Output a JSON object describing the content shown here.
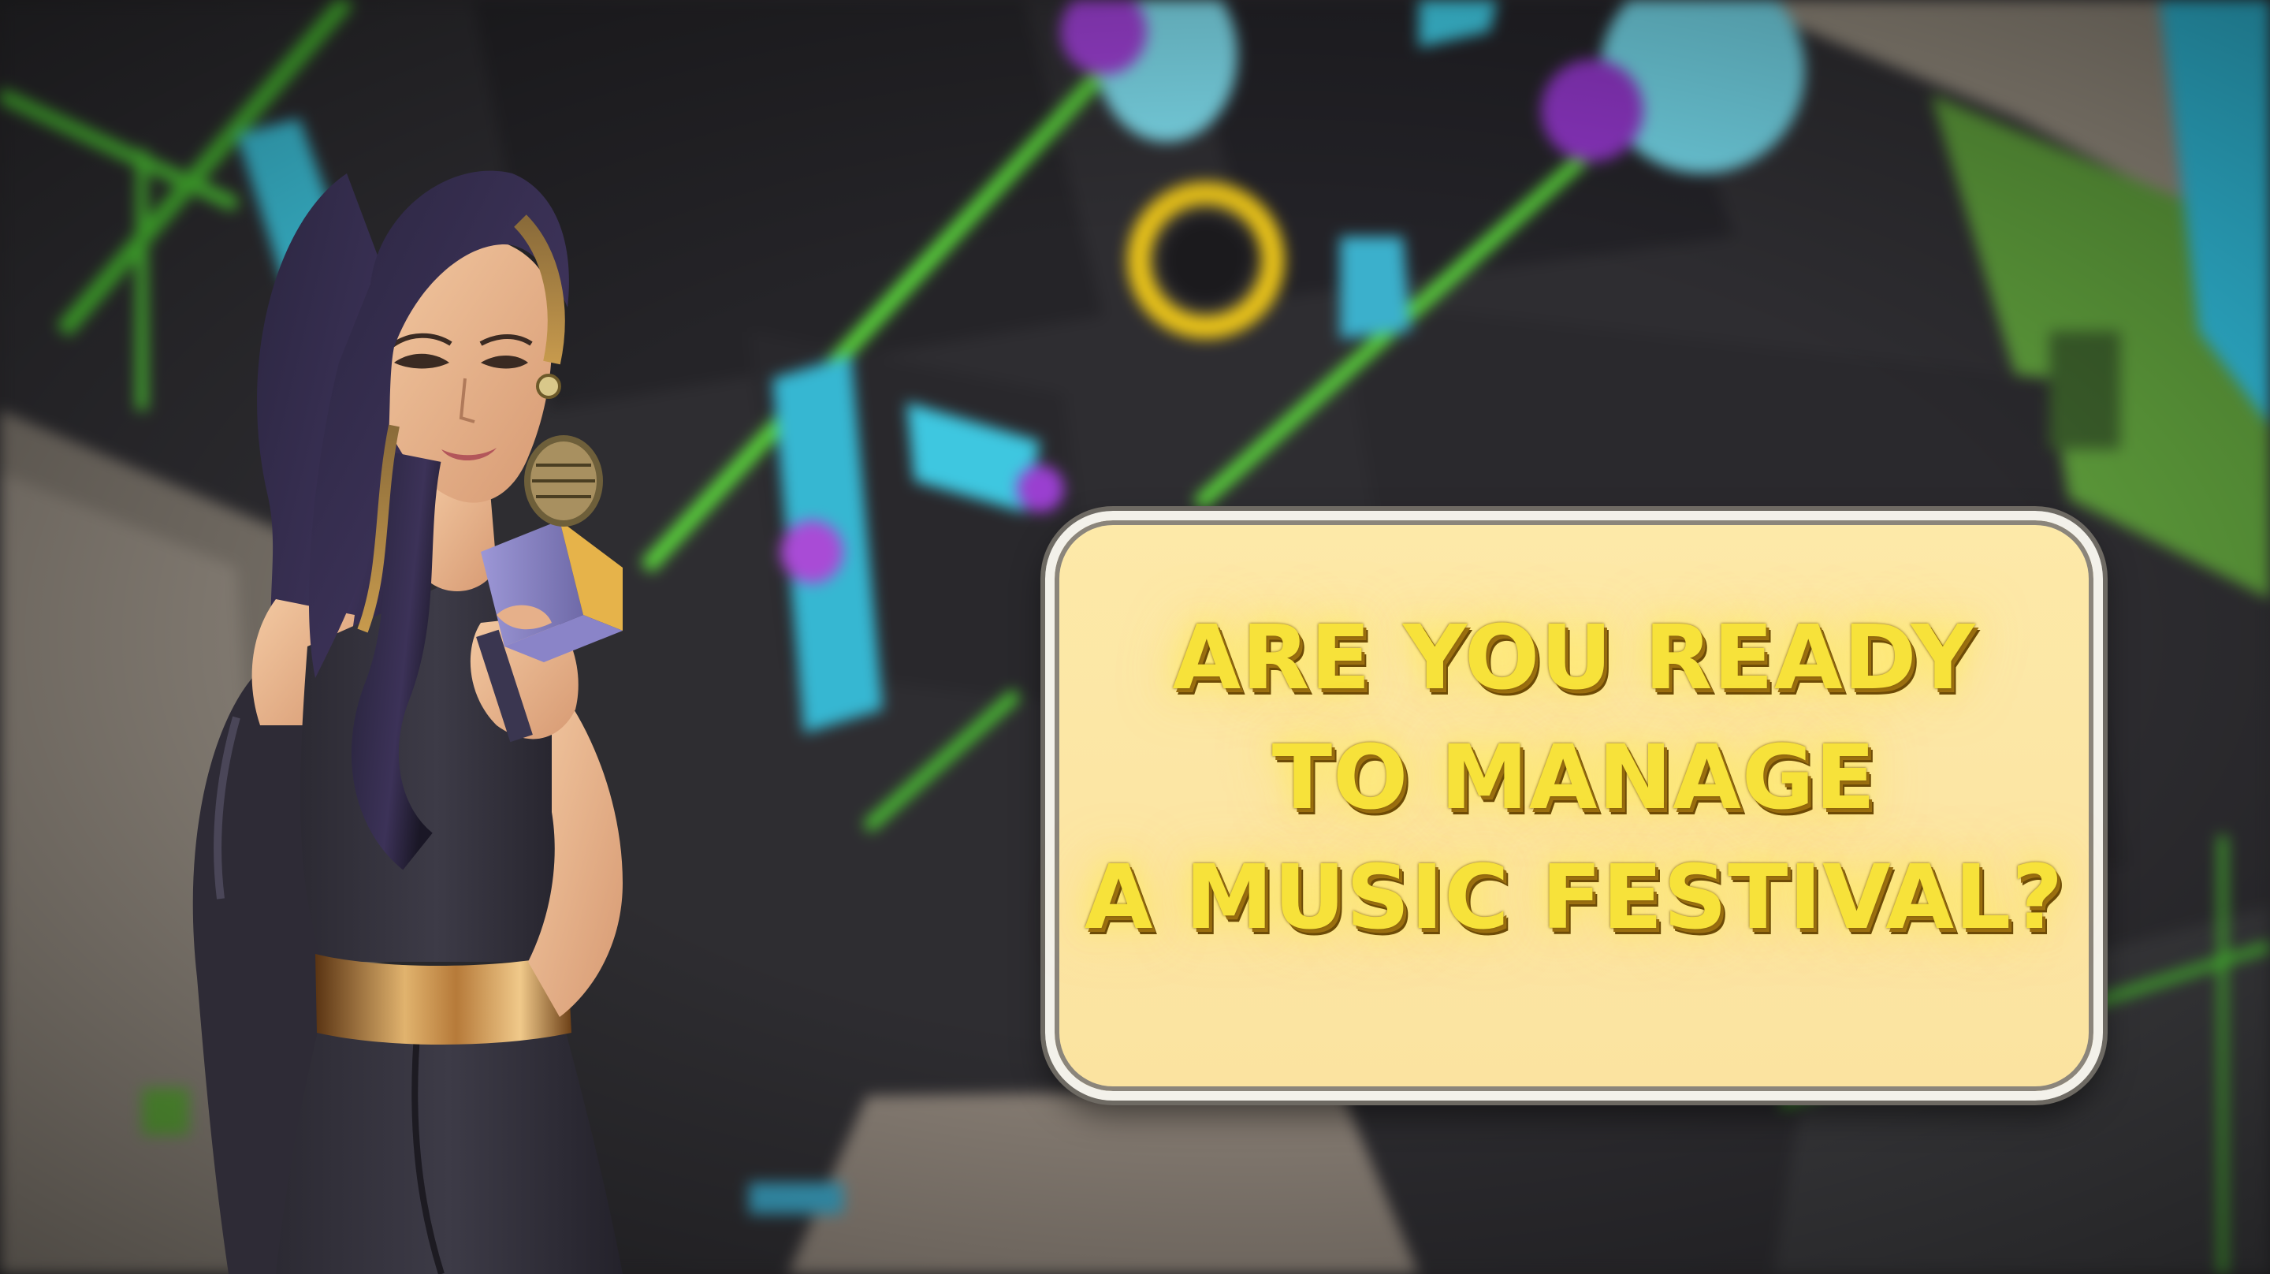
{
  "dialog": {
    "lines": [
      "ARE YOU READY",
      "TO MANAGE",
      "A MUSIC FESTIVAL?"
    ]
  },
  "colors": {
    "dialog_fill": "#fbe3a0",
    "dialog_border": "#f3f1ea",
    "headline_text": "#f7e23a",
    "neon_green": "#54d63a",
    "neon_cyan": "#3ec7e0",
    "neon_purple": "#9a3fd0"
  },
  "scene": {
    "background": "blurred-isometric-festival-map",
    "character": "presenter-holding-microphone"
  }
}
